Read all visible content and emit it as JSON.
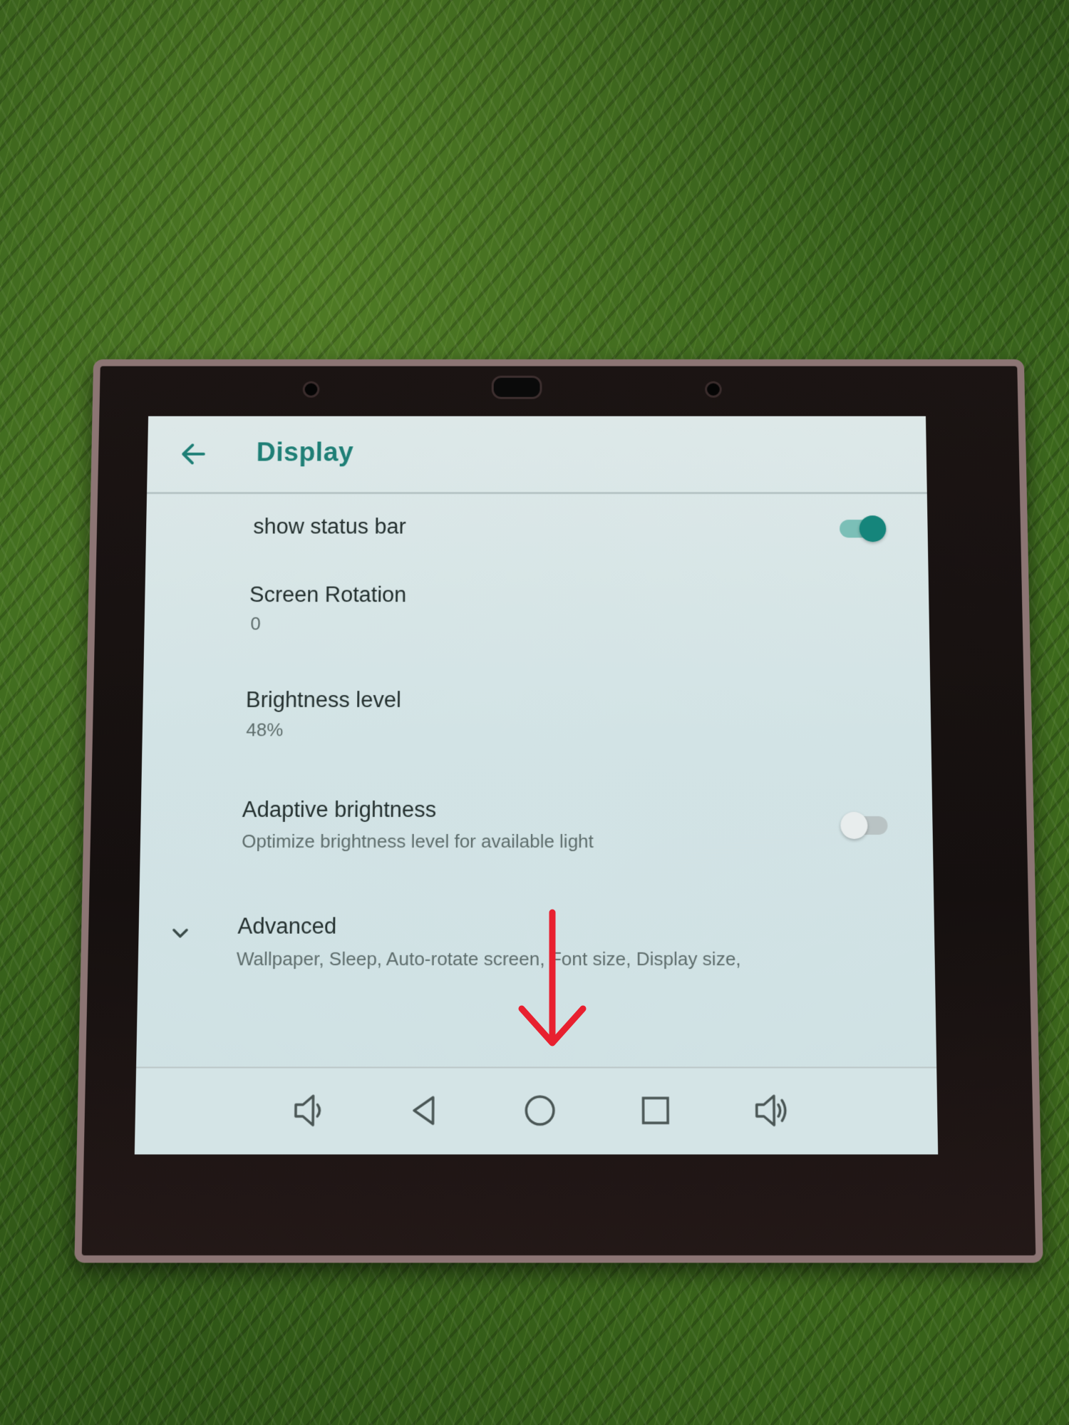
{
  "header": {
    "title": "Display"
  },
  "settings": [
    {
      "title": "show status bar",
      "toggle": "on"
    },
    {
      "title": "Screen Rotation",
      "summary": "0"
    },
    {
      "title": "Brightness level",
      "summary": "48%"
    },
    {
      "title": "Adaptive brightness",
      "summary": "Optimize brightness level for available light",
      "toggle": "off"
    },
    {
      "title": "Advanced",
      "summary": "Wallpaper, Sleep, Auto-rotate screen, Font size, Display size,"
    }
  ],
  "icons": {
    "back": "arrow-left-icon",
    "advanced": "chevron-down-icon",
    "nav": [
      "volume-down-icon",
      "back-triangle-icon",
      "home-circle-icon",
      "recents-square-icon",
      "volume-up-icon"
    ],
    "annotation": "red-down-arrow-icon"
  },
  "colors": {
    "accent": "#1f7f76",
    "toggle_on": "#15857b",
    "annotation": "#e8202f"
  }
}
